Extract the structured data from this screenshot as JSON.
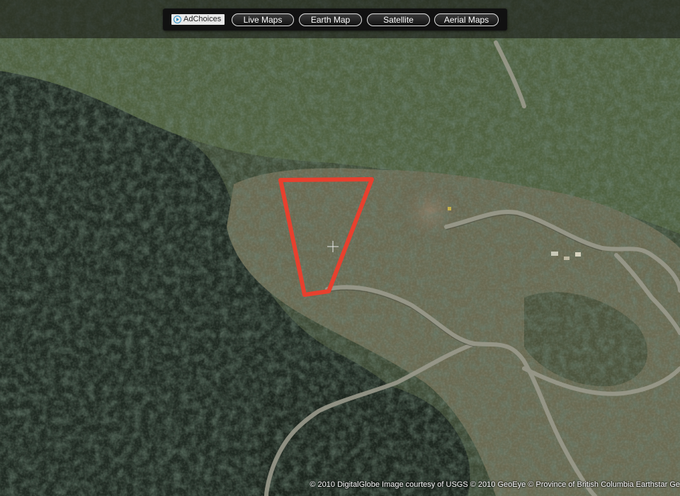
{
  "ad": {
    "label": "AdChoices",
    "icon": "adchoices-triangle-icon"
  },
  "nav": {
    "live_maps": "Live Maps",
    "earth_map": "Earth Map",
    "satellite": "Satellite",
    "aerial_maps": "Aerial Maps"
  },
  "map": {
    "type": "satellite imagery",
    "marker_color": "#e8402e",
    "crosshair_icon": "crosshair-icon"
  },
  "copyright": "© 2010 DigitalGlobe  Image courtesy of USGS  © 2010 GeoEye  © Province of British Columbia  Earthstar Ge"
}
